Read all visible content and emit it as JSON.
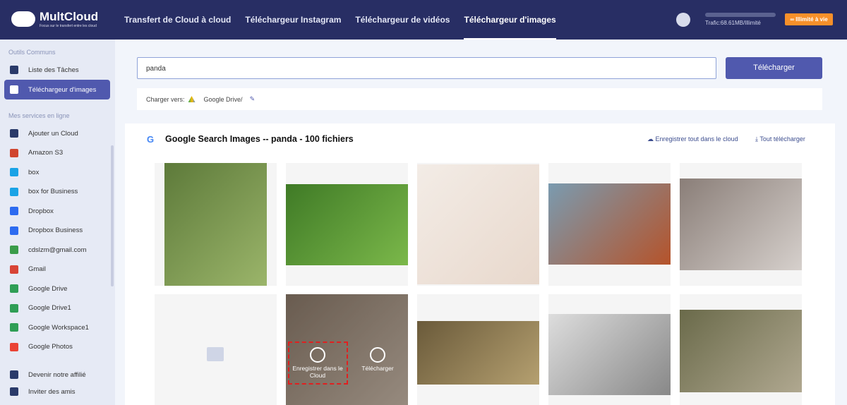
{
  "header": {
    "brand": "MultCloud",
    "tagline": "Focus sur le transfert entre les cloud",
    "nav": [
      {
        "label": "Transfert de Cloud à cloud"
      },
      {
        "label": "Téléchargeur Instagram"
      },
      {
        "label": "Téléchargeur de vidéos"
      },
      {
        "label": "Téléchargeur d'images"
      }
    ],
    "traffic": "Trafic:68.61MB/Illimité",
    "traffic_used_fraction": 0.0,
    "unlimited": "∞ Illimité à vie"
  },
  "sidebar": {
    "section1": "Outils Communs",
    "section2": "Mes services en ligne",
    "tools": [
      {
        "label": "Liste des Tâches",
        "icon": "list-icon"
      },
      {
        "label": "Téléchargeur d'images",
        "icon": "image-icon"
      }
    ],
    "services": [
      {
        "label": "Ajouter un Cloud",
        "color": "#2a3a6a"
      },
      {
        "label": "Amazon S3",
        "color": "#d0462f"
      },
      {
        "label": "box",
        "color": "#1aa3e6"
      },
      {
        "label": "box for Business",
        "color": "#1aa3e6"
      },
      {
        "label": "Dropbox",
        "color": "#2d6bf0"
      },
      {
        "label": "Dropbox Business",
        "color": "#2d6bf0"
      },
      {
        "label": "cdslzm@gmail.com",
        "color": "#3a9c4a"
      },
      {
        "label": "Gmail",
        "color": "#d84436"
      },
      {
        "label": "Google Drive",
        "color": "#2f9e56"
      },
      {
        "label": "Google Drive1",
        "color": "#2f9e56"
      },
      {
        "label": "Google Workspace1",
        "color": "#2f9e56"
      },
      {
        "label": "Google Photos",
        "color": "#ea4335"
      }
    ],
    "bottom": [
      {
        "label": "Devenir notre affilié"
      },
      {
        "label": "Inviter des amis"
      }
    ]
  },
  "search": {
    "value": "panda",
    "button": "Télécharger"
  },
  "charger": {
    "label": "Charger vers:",
    "path": "Google Drive/"
  },
  "results": {
    "title": "Google Search Images -- panda - 100 fichiers",
    "save_all": "Enregistrer tout dans le cloud",
    "download_all": "Tout télécharger",
    "overlay": {
      "save": "Enregistrer dans le Cloud",
      "download": "Télécharger"
    }
  }
}
